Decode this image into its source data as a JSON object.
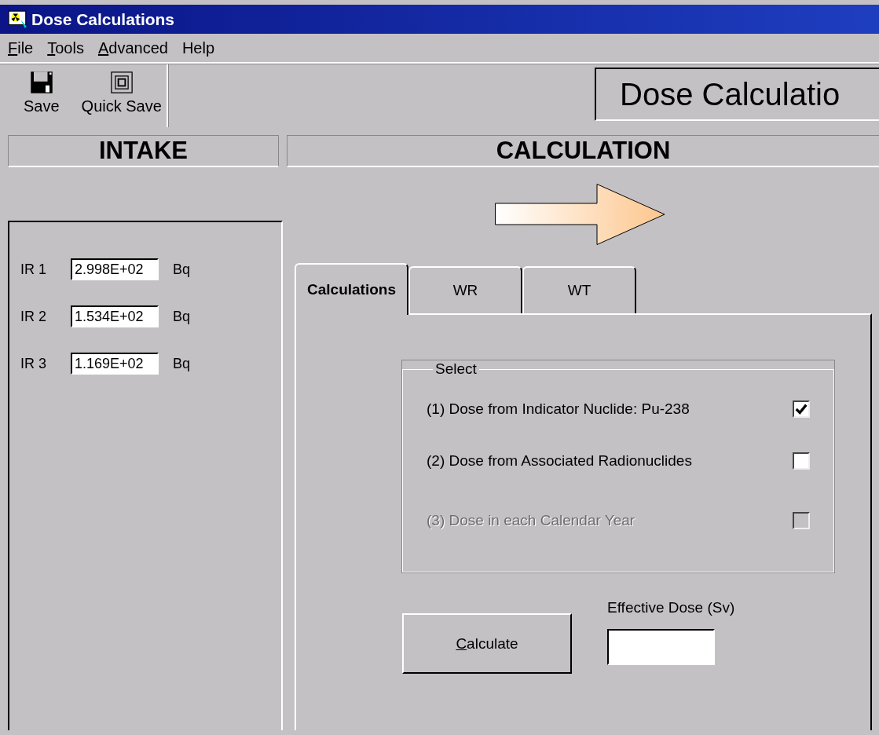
{
  "window": {
    "title": "Dose Calculations"
  },
  "menu": [
    {
      "label": "File",
      "mnemonic_first": true
    },
    {
      "label": "Tools",
      "mnemonic_first": true
    },
    {
      "label": "Advanced",
      "mnemonic_first": true
    },
    {
      "label": "Help",
      "mnemonic_first": false
    }
  ],
  "toolbar": [
    {
      "label": "Save",
      "kind": "floppy"
    },
    {
      "label": "Quick Save",
      "kind": "squares"
    }
  ],
  "banner": "Dose Calculatio",
  "intake": {
    "heading": "INTAKE",
    "rows": [
      {
        "label": "IR 1",
        "value": "2.998E+02",
        "unit": "Bq"
      },
      {
        "label": "IR 2",
        "value": "1.534E+02",
        "unit": "Bq"
      },
      {
        "label": "IR 3",
        "value": "1.169E+02",
        "unit": "Bq"
      }
    ]
  },
  "calculation": {
    "heading": "CALCULATION",
    "tabs": [
      {
        "label": "Calculations",
        "selected": true
      },
      {
        "label": "WR",
        "selected": false
      },
      {
        "label": "WT",
        "selected": false
      }
    ],
    "group_title": "Select",
    "options": [
      {
        "label": "(1) Dose from Indicator Nuclide: Pu-238",
        "checked": true,
        "disabled": false
      },
      {
        "label": "(2) Dose from Associated Radionuclides",
        "checked": false,
        "disabled": false
      },
      {
        "label": "(3) Dose in each Calendar Year",
        "checked": false,
        "disabled": true
      }
    ],
    "button": {
      "label": "Calculate",
      "mnemonic_first": true
    },
    "result_label": "Effective Dose (Sv)"
  }
}
